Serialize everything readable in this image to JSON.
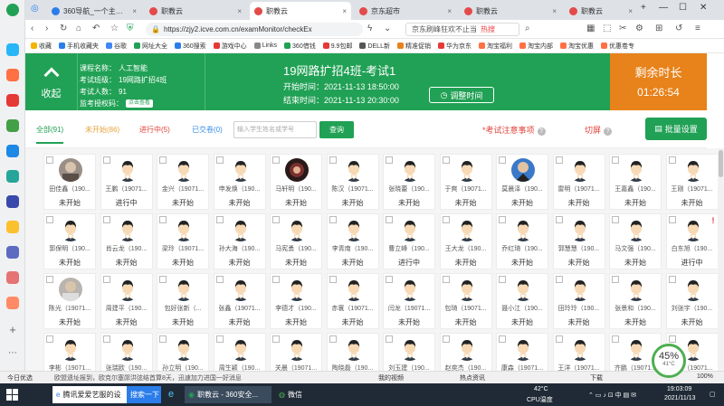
{
  "browser": {
    "tabs": [
      {
        "label": "360导航_一个主页，整个世界",
        "color": "#2b7de9",
        "active": false
      },
      {
        "label": "职教云",
        "color": "#e34a4a",
        "active": false
      },
      {
        "label": "职教云",
        "color": "#e34a4a",
        "active": true
      },
      {
        "label": "京东超市",
        "color": "#e34a4a",
        "active": false
      },
      {
        "label": "职教云",
        "color": "#e34a4a",
        "active": false
      },
      {
        "label": "职教云",
        "color": "#e34a4a",
        "active": false
      }
    ],
    "url": "https://zjy2.icve.com.cn/examMonitor/checkEx",
    "search_text": "京东刷峰狂欢不止当",
    "search_hot": "热搜",
    "bookmarks": [
      "收藏",
      "手机收藏夹",
      "谷歌",
      "网址大全",
      "360搜索",
      "游戏中心",
      "Links",
      "360借钱",
      "9.9包邮",
      "DELL新",
      "精准促销",
      "华为京东",
      "淘宝福利",
      "淘宝内部",
      "淘宝优惠",
      "优惠卷专"
    ]
  },
  "header": {
    "collapse_label": "收起",
    "course_label": "课程名称：",
    "course_value": "人工智能",
    "class_label": "考试班级：",
    "class_value": "19网路扩招4班",
    "count_label": "考试人数：",
    "count_value": "91",
    "code_label": "监考授权码：",
    "code_button": "点击查看",
    "exam_title": "19网路扩招4班-考试1",
    "start_label": "开始时间：",
    "start_value": "2021-11-13 18:50:00",
    "end_label": "结束时间：",
    "end_value": "2021-11-13 20:30:00",
    "adjust_button": "调整时间",
    "remain_label": "剩余时长",
    "remain_value": "01:26:54"
  },
  "filter": {
    "tabs": [
      {
        "label": "全部(91)",
        "color": "#21a155"
      },
      {
        "label": "未开始(86)",
        "color": "#e8a33b"
      },
      {
        "label": "进行中(5)",
        "color": "#e0433b"
      },
      {
        "label": "已交卷(0)",
        "color": "#3a8ee6"
      }
    ],
    "search_placeholder": "输入学生姓名或学号",
    "search_button": "查询",
    "notice": "*考试注意事项",
    "switch": "切屏",
    "batch_button": "批量设置"
  },
  "students": [
    {
      "name": "田佳鑫（190...",
      "status": "未开始",
      "avatar": "photo"
    },
    {
      "name": "王鹏（19071...",
      "status": "进行中",
      "avatar": "cartoon"
    },
    {
      "name": "金兴（19071...",
      "status": "未开始",
      "avatar": "cartoon"
    },
    {
      "name": "申发焕（190...",
      "status": "未开始",
      "avatar": "cartoon"
    },
    {
      "name": "马轩明（190...",
      "status": "未开始",
      "avatar": "dark"
    },
    {
      "name": "陈汉（19071...",
      "status": "未开始",
      "avatar": "cartoon"
    },
    {
      "name": "张晓蕾（190...",
      "status": "未开始",
      "avatar": "cartoon"
    },
    {
      "name": "于爽（19071...",
      "status": "未开始",
      "avatar": "cartoon"
    },
    {
      "name": "莫晨泽（190...",
      "status": "未开始",
      "avatar": "man"
    },
    {
      "name": "雷明（19071...",
      "status": "未开始",
      "avatar": "cartoon"
    },
    {
      "name": "王嘉鑫（190...",
      "status": "未开始",
      "avatar": "cartoon"
    },
    {
      "name": "王刚（19071...",
      "status": "未开始",
      "avatar": "cartoon"
    },
    {
      "name": "郭保明（190...",
      "status": "未开始",
      "avatar": "cartoon"
    },
    {
      "name": "肖云龙（190...",
      "status": "未开始",
      "avatar": "cartoon"
    },
    {
      "name": "梁玲（19071...",
      "status": "未开始",
      "avatar": "cartoon"
    },
    {
      "name": "孙大海（190...",
      "status": "未开始",
      "avatar": "cartoon"
    },
    {
      "name": "马宪勇（190...",
      "status": "未开始",
      "avatar": "cartoon"
    },
    {
      "name": "李青南（190...",
      "status": "未开始",
      "avatar": "cartoon"
    },
    {
      "name": "曹立峰（190...",
      "status": "进行中",
      "avatar": "cartoon"
    },
    {
      "name": "王大龙（190...",
      "status": "未开始",
      "avatar": "cartoon"
    },
    {
      "name": "乔红琦（190...",
      "status": "未开始",
      "avatar": "cartoon"
    },
    {
      "name": "郭慧慧（190...",
      "status": "未开始",
      "avatar": "cartoon"
    },
    {
      "name": "马文强（190...",
      "status": "未开始",
      "avatar": "cartoon"
    },
    {
      "name": "白东旭（190...",
      "status": "进行中",
      "avatar": "cartoon",
      "warn": true
    },
    {
      "name": "陈光（19071...",
      "status": "未开始",
      "avatar": "photo2"
    },
    {
      "name": "周建平（190...",
      "status": "未开始",
      "avatar": "cartoon"
    },
    {
      "name": "包好张新（...",
      "status": "未开始",
      "avatar": "cartoon"
    },
    {
      "name": "张鑫（19071...",
      "status": "未开始",
      "avatar": "cartoon"
    },
    {
      "name": "李德才（190...",
      "status": "未开始",
      "avatar": "cartoon"
    },
    {
      "name": "赤寰（19071...",
      "status": "未开始",
      "avatar": "cartoon"
    },
    {
      "name": "闫龙（19071...",
      "status": "未开始",
      "avatar": "cartoon"
    },
    {
      "name": "包琦（19071...",
      "status": "未开始",
      "avatar": "cartoon"
    },
    {
      "name": "聂小江（190...",
      "status": "未开始",
      "avatar": "cartoon"
    },
    {
      "name": "田玲玲（190...",
      "status": "未开始",
      "avatar": "cartoon"
    },
    {
      "name": "张景和（190...",
      "status": "未开始",
      "avatar": "cartoon"
    },
    {
      "name": "刘张宇（190...",
      "status": "未开始",
      "avatar": "cartoon"
    },
    {
      "name": "李彬（19071...",
      "status": "",
      "avatar": "cartoon"
    },
    {
      "name": "张瑞欧（190...",
      "status": "",
      "avatar": "cartoon"
    },
    {
      "name": "孙立明（190...",
      "status": "",
      "avatar": "cartoon"
    },
    {
      "name": "周生颖（190...",
      "status": "",
      "avatar": "cartoon"
    },
    {
      "name": "关晨（19071...",
      "status": "",
      "avatar": "cartoon"
    },
    {
      "name": "陶晓磊（190...",
      "status": "",
      "avatar": "cartoon"
    },
    {
      "name": "刘玉建（190...",
      "status": "",
      "avatar": "cartoon"
    },
    {
      "name": "赵奕杰（190...",
      "status": "",
      "avatar": "cartoon"
    },
    {
      "name": "康森（19071...",
      "status": "",
      "avatar": "cartoon"
    },
    {
      "name": "王洋（19071...",
      "status": "",
      "avatar": "cartoon"
    },
    {
      "name": "齐鹏（19071...",
      "status": "",
      "avatar": "cartoon"
    },
    {
      "name": "王磊（19071...",
      "status": "",
      "avatar": "cartoon"
    }
  ],
  "statusbar": {
    "left": "今日优选",
    "news": "欧盟遗址报到，欧克尔塞郧洪弦结首算8天，迅速加力进国一好消息",
    "items": [
      "我的视频",
      "热点资讯",
      "下载",
      "100%"
    ]
  },
  "taskbar": {
    "items": [
      "腾讯爱爱艺服的设",
      "搜索一下",
      "职教云 - 360安全...",
      "微信"
    ],
    "weather_temp": "42°C",
    "weather_label": "CPU温度",
    "time": "19:03:09",
    "date": "2021/11/13",
    "badge_percent": "45%",
    "badge_temp": "41°C"
  }
}
